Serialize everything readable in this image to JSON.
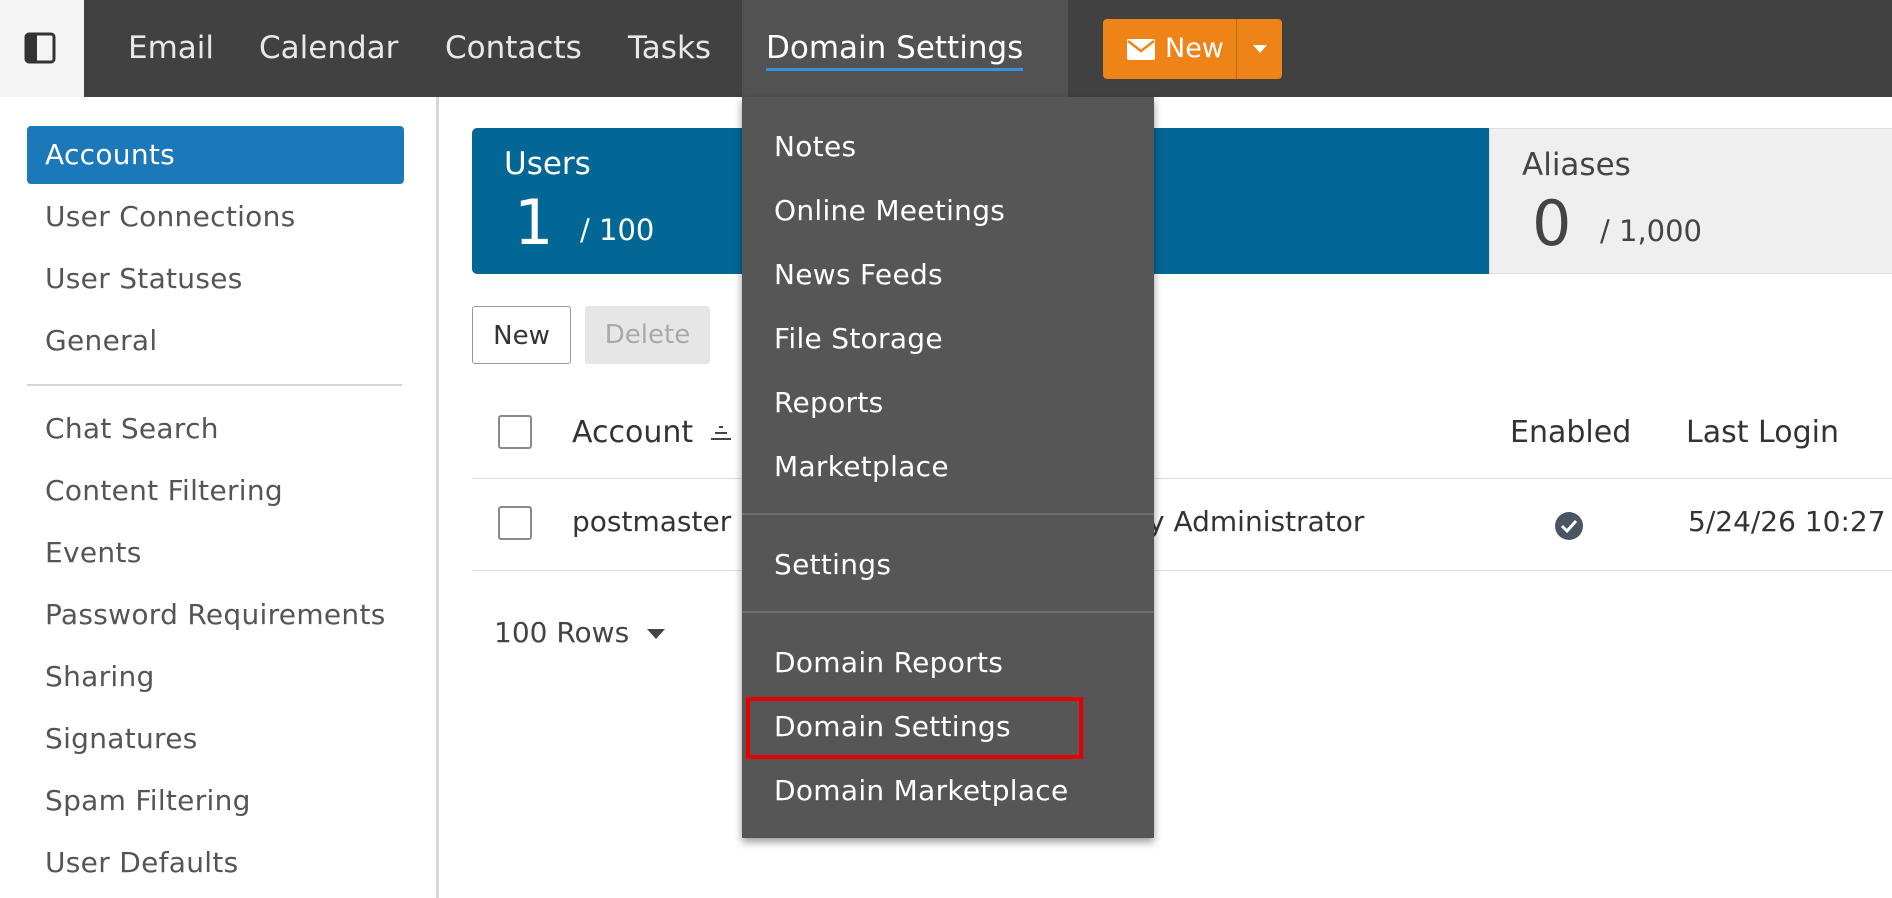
{
  "topnav": {
    "items": [
      "Email",
      "Calendar",
      "Contacts",
      "Tasks"
    ],
    "active": "Domain Settings",
    "new_label": "New"
  },
  "sidebar": {
    "group1": [
      "Accounts",
      "User Connections",
      "User Statuses",
      "General"
    ],
    "group2": [
      "Chat Search",
      "Content Filtering",
      "Events",
      "Password Requirements",
      "Sharing",
      "Signatures",
      "Spam Filtering",
      "User Defaults"
    ],
    "active": "Accounts"
  },
  "stats": {
    "users": {
      "label": "Users",
      "count": "1",
      "total": "/ 100"
    },
    "aliases": {
      "label": "Aliases",
      "count": "0",
      "total": "/ 1,000"
    }
  },
  "toolbar": {
    "new_label": "New",
    "delete_label": "Delete"
  },
  "table": {
    "columns": [
      "Account",
      "Enabled",
      "Last Login"
    ],
    "rows": [
      {
        "account": "postmaster",
        "role": "y Administrator",
        "enabled": "check-circle-icon",
        "last_login": "5/24/26 10:27"
      }
    ],
    "page_size": "100 Rows"
  },
  "dropdown": {
    "section1": [
      "Notes",
      "Online Meetings",
      "News Feeds",
      "File Storage",
      "Reports",
      "Marketplace"
    ],
    "section2": [
      "Settings"
    ],
    "section3": [
      "Domain Reports",
      "Domain Settings",
      "Domain Marketplace"
    ],
    "highlighted": "Domain Settings"
  },
  "colors": {
    "accent": "#1b78b9",
    "users_card": "#036795",
    "new_button": "#ee8418",
    "topbar": "#414141",
    "highlight": "#e60000"
  }
}
